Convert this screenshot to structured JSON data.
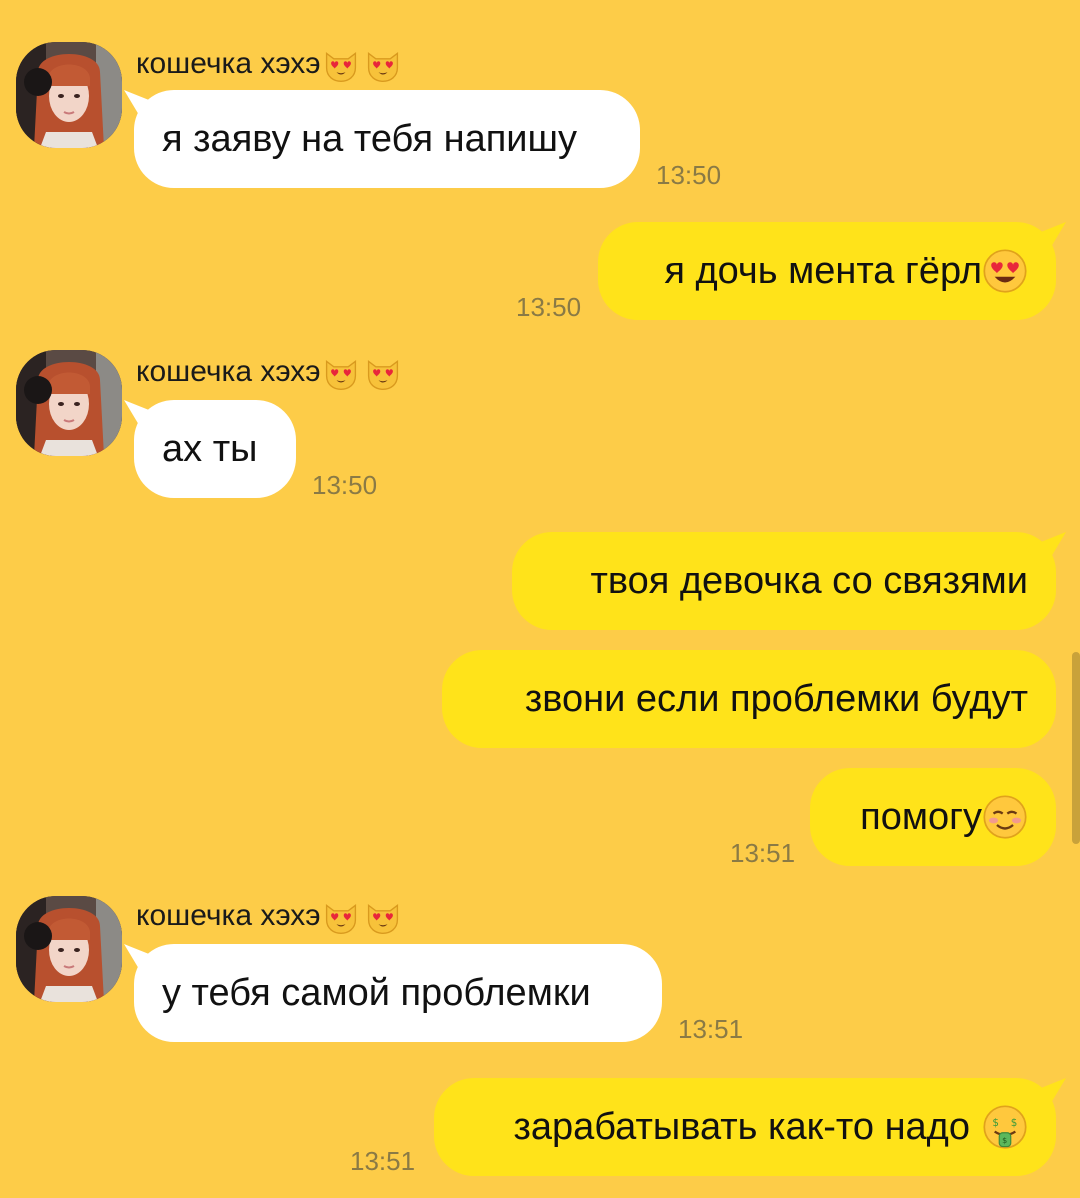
{
  "chat": {
    "messages": [
      {
        "sender": "кошечка хэхэ",
        "text": "я заяву на тебя напишу",
        "time": "13:50"
      },
      {
        "text": "я дочь мента гёрл",
        "time": "13:50",
        "emoji": "heart-eyes-emoji"
      },
      {
        "sender": "кошечка хэхэ",
        "text": "ах ты",
        "time": "13:50"
      },
      {
        "text": "твоя девочка со связями"
      },
      {
        "text": "звони если проблемки будут"
      },
      {
        "text": "помогу",
        "time": "13:51",
        "emoji": "smiling-blush-emoji"
      },
      {
        "sender": "кошечка хэхэ",
        "text": "у тебя самой проблемки",
        "time": "13:51"
      },
      {
        "text": "зарабатывать как-то надо",
        "time": "13:51",
        "emoji": "money-mouth-emoji"
      }
    ],
    "sender_emoji": "heart-eyes-cat-emoji",
    "colors": {
      "background": "#FDCC48",
      "incoming_bubble": "#FFFFFF",
      "outgoing_bubble": "#FFE31A",
      "timestamp": "#8a7a45"
    }
  }
}
